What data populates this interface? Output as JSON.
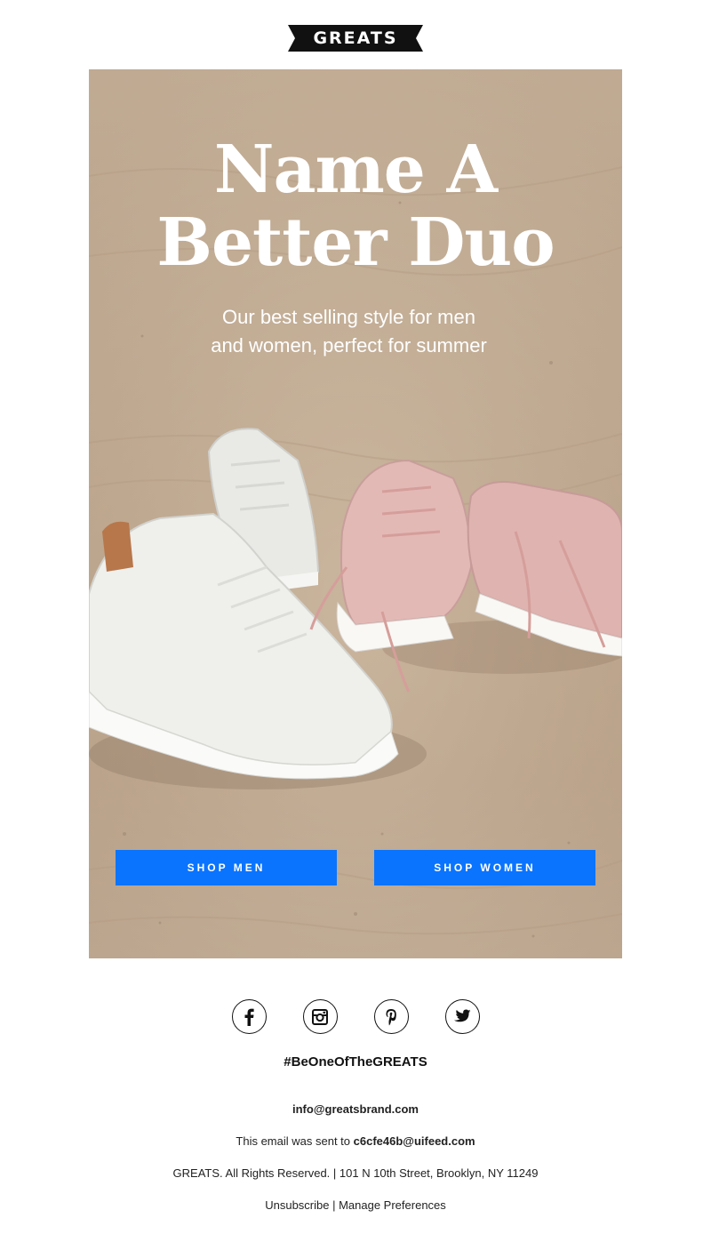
{
  "brand": {
    "logo_text": "GREATS"
  },
  "hero": {
    "headline_line1": "Name A",
    "headline_line2": "Better Duo",
    "subhead_line1": "Our best selling style for men",
    "subhead_line2": "and women, perfect for summer",
    "image_description_icon": "sneakers-on-sand-image"
  },
  "buttons": {
    "shop_men": "SHOP MEN",
    "shop_women": "SHOP WOMEN",
    "color": "#0a74ff"
  },
  "social": {
    "icons": [
      "facebook-icon",
      "instagram-icon",
      "pinterest-icon",
      "twitter-icon"
    ]
  },
  "hashtag": "#BeOneOfTheGREATS",
  "footer": {
    "email": "info@greatsbrand.com",
    "sent_to_prefix": "This email was sent to ",
    "sent_to_address": "c6cfe46b@uifeed.com",
    "rights": "GREATS. All Rights Reserved. | 101 N 10th Street, Brooklyn, NY 11249",
    "unsubscribe": "Unsubscribe",
    "separator": " | ",
    "manage_preferences": "Manage Preferences"
  }
}
